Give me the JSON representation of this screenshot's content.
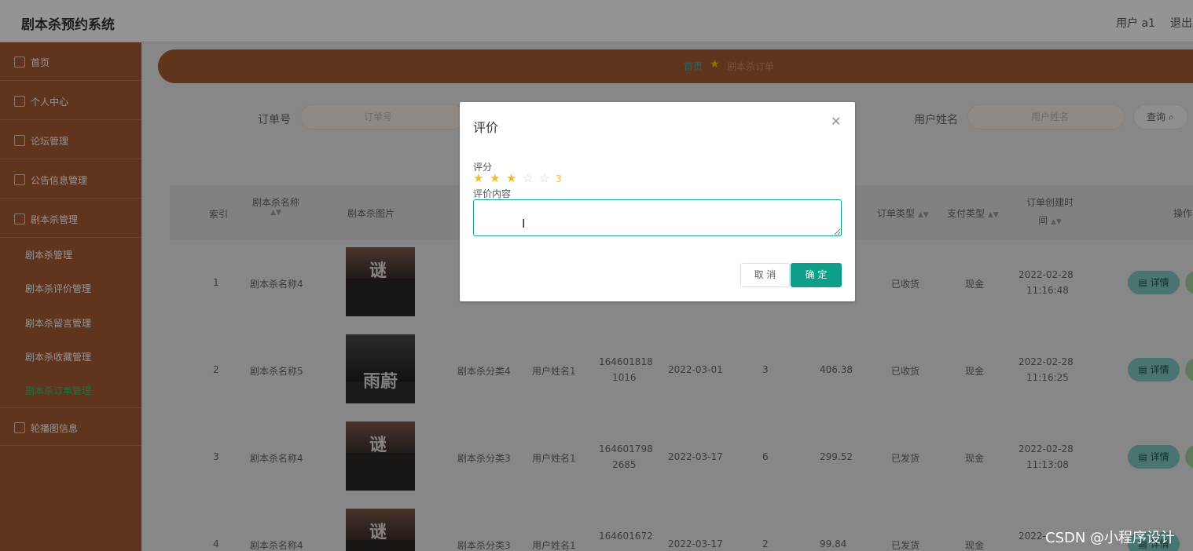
{
  "header": {
    "app_title": "剧本杀预约系统",
    "user_label": "用户 a1",
    "logout_label": "退出"
  },
  "sidebar": {
    "items": [
      {
        "label": "首页",
        "icon": "home-icon"
      },
      {
        "label": "个人中心",
        "icon": "user-icon"
      },
      {
        "label": "论坛管理",
        "icon": "forum-icon"
      },
      {
        "label": "公告信息管理",
        "icon": "notice-icon"
      },
      {
        "label": "剧本杀管理",
        "icon": "script-icon"
      }
    ],
    "sub_items": [
      {
        "label": "剧本杀管理",
        "active": false
      },
      {
        "label": "剧本杀评价管理",
        "active": false
      },
      {
        "label": "剧本杀留言管理",
        "active": false
      },
      {
        "label": "剧本杀收藏管理",
        "active": false
      },
      {
        "label": "剧本杀订单管理",
        "active": true
      }
    ],
    "last_item": {
      "label": "轮播图信息",
      "icon": "carousel-icon"
    }
  },
  "breadcrumb": {
    "home": "首页",
    "current": "剧本杀订单"
  },
  "search": {
    "order_no_label": "订单号",
    "order_no_placeholder": "订单号",
    "user_name_label": "用户姓名",
    "user_name_placeholder": "用户姓名",
    "search_button": "查询"
  },
  "table": {
    "headers": {
      "index": "索引",
      "script_name": "剧本杀名称",
      "script_image": "剧本杀图片",
      "order_type": "订单类型",
      "pay_type": "支付类型",
      "created_1": "订单创建时",
      "created_2": "间",
      "actions": "操作"
    },
    "detail_label": "详情",
    "rows": [
      {
        "index": "1",
        "name": "剧本杀名称4",
        "category": "",
        "user": "",
        "order_no_1": "",
        "order_no_2": "",
        "date": "",
        "qty": "",
        "price": "",
        "order_type": "已收货",
        "pay_type": "现金",
        "created_date": "2022-02-28",
        "created_time": "11:16:48",
        "image_text": "谜"
      },
      {
        "index": "2",
        "name": "剧本杀名称5",
        "category": "剧本杀分类4",
        "user": "用户姓名1",
        "order_no_1": "164601818",
        "order_no_2": "1016",
        "date": "2022-03-01",
        "qty": "3",
        "price": "406.38",
        "order_type": "已收货",
        "pay_type": "现金",
        "created_date": "2022-02-28",
        "created_time": "11:16:25",
        "image_text": "雨蔚"
      },
      {
        "index": "3",
        "name": "剧本杀名称4",
        "category": "剧本杀分类3",
        "user": "用户姓名1",
        "order_no_1": "164601798",
        "order_no_2": "2685",
        "date": "2022-03-17",
        "qty": "6",
        "price": "299.52",
        "order_type": "已发货",
        "pay_type": "现金",
        "created_date": "2022-02-28",
        "created_time": "11:13:08",
        "image_text": "谜"
      },
      {
        "index": "4",
        "name": "剧本杀名称4",
        "category": "剧本杀分类3",
        "user": "用户姓名1",
        "order_no_1": "164601672",
        "order_no_2": "",
        "date": "2022-03-17",
        "qty": "2",
        "price": "99.84",
        "order_type": "已发货",
        "pay_type": "现金",
        "created_date": "2022-",
        "created_time": "",
        "image_text": "谜"
      }
    ]
  },
  "dialog": {
    "title": "评价",
    "rating_label": "评分",
    "rating_value": 3,
    "rating_max": 5,
    "rating_text": "3",
    "content_label": "评价内容",
    "content_value": "",
    "cancel_label": "取 消",
    "ok_label": "确 定"
  },
  "watermark": "CSDN @小程序设计",
  "colors": {
    "sidebar": "#a55a33",
    "accent": "#0e9e8a",
    "star": "#f7ba2a",
    "active_menu": "#39c06b"
  }
}
